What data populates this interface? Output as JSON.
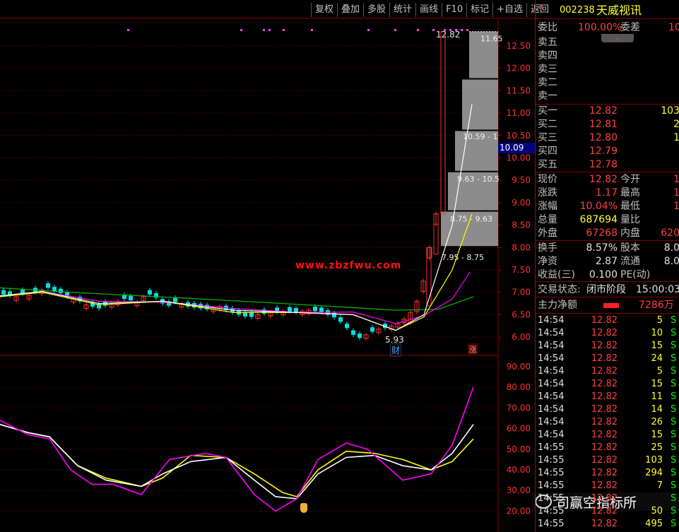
{
  "toolbar": {
    "items": [
      "复权",
      "叠加",
      "多股",
      "统计",
      "画线",
      "F10",
      "标记",
      "+自选",
      "返回"
    ]
  },
  "stock": {
    "badge": "R",
    "code": "002238",
    "name": "天威视讯"
  },
  "weibi": {
    "label1": "委比",
    "value1": "100.00%",
    "label2": "委差",
    "value2": "10"
  },
  "sell": [
    {
      "label": "卖五"
    },
    {
      "label": "卖四"
    },
    {
      "label": "卖三"
    },
    {
      "label": "卖二"
    },
    {
      "label": "卖一"
    }
  ],
  "buy": [
    {
      "label": "买一",
      "price": "12.82",
      "vol": "103"
    },
    {
      "label": "买二",
      "price": "12.81",
      "vol": "2"
    },
    {
      "label": "买三",
      "price": "12.80",
      "vol": "1"
    },
    {
      "label": "买四",
      "price": "12.79",
      "vol": ""
    },
    {
      "label": "买五",
      "price": "12.78",
      "vol": ""
    }
  ],
  "quote": [
    {
      "l1": "现价",
      "v1": "12.82",
      "c1": "red",
      "l2": "今开",
      "v2": "1"
    },
    {
      "l1": "涨跌",
      "v1": "1.17",
      "c1": "red",
      "l2": "最高",
      "v2": "1"
    },
    {
      "l1": "涨幅",
      "v1": "10.04%",
      "c1": "red",
      "l2": "最低",
      "v2": "1"
    },
    {
      "l1": "总量",
      "v1": "687694",
      "c1": "yel",
      "l2": "量比",
      "v2": ""
    },
    {
      "l1": "外盘",
      "v1": "67268",
      "c1": "red",
      "l2": "内盘",
      "v2": "620"
    }
  ],
  "fin": [
    {
      "l1": "换手",
      "v1": "8.57%",
      "l2": "股本",
      "v2": "8.0"
    },
    {
      "l1": "净资",
      "v1": "2.87",
      "l2": "流通",
      "v2": "8.0"
    },
    {
      "l1": "收益(三)",
      "v1": "0.100",
      "l2": "PE(动)",
      "v2": ""
    }
  ],
  "status": {
    "label": "交易状态:",
    "value": "闭市阶段",
    "time": "15:00:03"
  },
  "mainflow": {
    "label": "主力净额",
    "value": "7286万"
  },
  "ticks": [
    {
      "t": "14:54",
      "p": "12.82",
      "v": "5",
      "s": "S"
    },
    {
      "t": "14:54",
      "p": "12.82",
      "v": "10",
      "s": "S"
    },
    {
      "t": "14:54",
      "p": "12.82",
      "v": "15",
      "s": "S"
    },
    {
      "t": "14:54",
      "p": "12.82",
      "v": "24",
      "s": "S"
    },
    {
      "t": "14:54",
      "p": "12.82",
      "v": "5",
      "s": "S"
    },
    {
      "t": "14:54",
      "p": "12.82",
      "v": "15",
      "s": "S"
    },
    {
      "t": "14:54",
      "p": "12.82",
      "v": "11",
      "s": "S"
    },
    {
      "t": "14:54",
      "p": "12.82",
      "v": "14",
      "s": "S"
    },
    {
      "t": "14:54",
      "p": "12.82",
      "v": "26",
      "s": "S"
    },
    {
      "t": "14:54",
      "p": "12.82",
      "v": "15",
      "s": "S"
    },
    {
      "t": "14:55",
      "p": "12.82",
      "v": "25",
      "s": "S"
    },
    {
      "t": "14:55",
      "p": "12.82",
      "v": "103",
      "s": "S"
    },
    {
      "t": "14:55",
      "p": "12.82",
      "v": "294",
      "s": "S"
    },
    {
      "t": "14:55",
      "p": "12.82",
      "v": "7",
      "s": "S"
    },
    {
      "t": "14:55",
      "p": "12.82",
      "v": "",
      "s": "S"
    },
    {
      "t": "14:55",
      "p": "12.82",
      "v": "50",
      "s": "S"
    },
    {
      "t": "14:55",
      "p": "12.82",
      "v": "495",
      "s": "S"
    }
  ],
  "price_axis": {
    "ticks": [
      "12.50",
      "12.00",
      "11.50",
      "11.00",
      "10.50",
      "10.00",
      "9.50",
      "9.00",
      "8.50",
      "8.00",
      "7.50",
      "7.00",
      "6.50",
      "6.00"
    ],
    "current": "10.09"
  },
  "osc_axis": {
    "ticks": [
      "90.00",
      "80.00",
      "70.00",
      "60.00",
      "50.00",
      "40.00",
      "30.00",
      "20.00"
    ]
  },
  "annotations": {
    "high": "12.82",
    "low": "5.93",
    "watermark": "www.zbzfwu.com",
    "marker_cai": "财",
    "marker_zhang": "涨",
    "corner": "司赢空指标所"
  },
  "chip_labels": [
    "11.65",
    "10.59 - 1",
    "9.63 - 10.5",
    "8.75 - 9.63",
    "7.95 - 8.75"
  ],
  "colors": {
    "up": "#ff3030",
    "down": "#00e0e0",
    "ma_white": "#ffffff",
    "ma_yellow": "#ffff00",
    "ma_magenta": "#ff00ff",
    "ma_green": "#00c000",
    "grid": "#900000"
  }
}
